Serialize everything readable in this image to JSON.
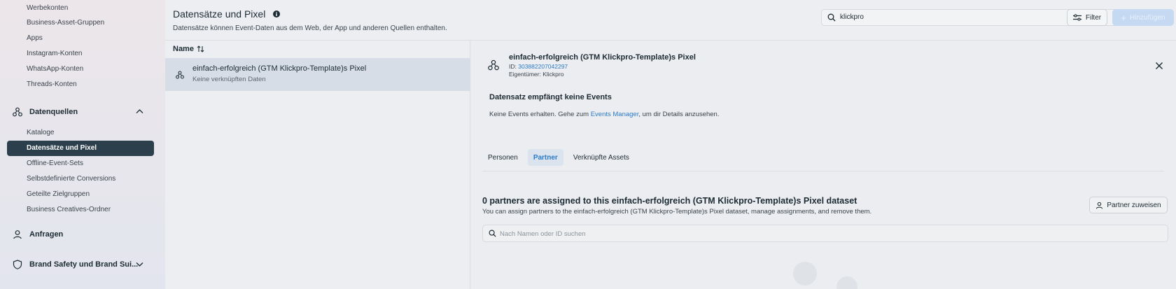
{
  "sidebar": {
    "items_top": [
      "Werbekonten",
      "Business-Asset-Gruppen",
      "Apps",
      "Instagram-Konten",
      "WhatsApp-Konten",
      "Threads-Konten"
    ],
    "section_datenquellen": "Datenquellen",
    "items_datenquellen": [
      "Kataloge",
      "Datensätze und Pixel",
      "Offline-Event-Sets",
      "Selbstdefinierte Conversions",
      "Geteilte Zielgruppen",
      "Business Creatives-Ordner"
    ],
    "section_anfragen": "Anfragen",
    "section_brand": "Brand Safety und Brand Sui..."
  },
  "header": {
    "title": "Datensätze und Pixel",
    "subtitle": "Datensätze können Event-Daten aus dem Web, der App und anderen Quellen enthalten.",
    "search_value": "klickpro",
    "filter_label": "Filter",
    "add_label": "Hinzufügen"
  },
  "list": {
    "column_header": "Name",
    "rows": [
      {
        "title": "einfach-erfolgreich (GTM Klickpro-Template)s Pixel",
        "subtitle": "Keine verknüpften Daten"
      }
    ]
  },
  "detail": {
    "title": "einfach-erfolgreich (GTM Klickpro-Template)s Pixel",
    "id_label": "ID:",
    "id_value": "303882207042297",
    "owner": "Eigentümer: Klickpro",
    "notice_title": "Datensatz empfängt keine Events",
    "notice_text_before": "Keine Events erhalten. Gehe zum ",
    "notice_link": "Events Manager",
    "notice_text_after": ", um dir Details anzusehen.",
    "tabs": [
      "Personen",
      "Partner",
      "Verknüpfte Assets"
    ],
    "active_tab": "Partner",
    "partners_title": "0 partners are assigned to this einfach-erfolgreich (GTM Klickpro-Template)s Pixel dataset",
    "partners_subtitle": "You can assign partners to the einfach-erfolgreich (GTM Klickpro-Template)s Pixel dataset, manage assignments, and remove them.",
    "assign_label": "Partner zuweisen",
    "search_placeholder": "Nach Namen oder ID suchen"
  },
  "colors": {
    "accent": "#2c7bc8",
    "sidebar_selected": "#2c3f4c",
    "row_selected": "#d6dde7"
  }
}
